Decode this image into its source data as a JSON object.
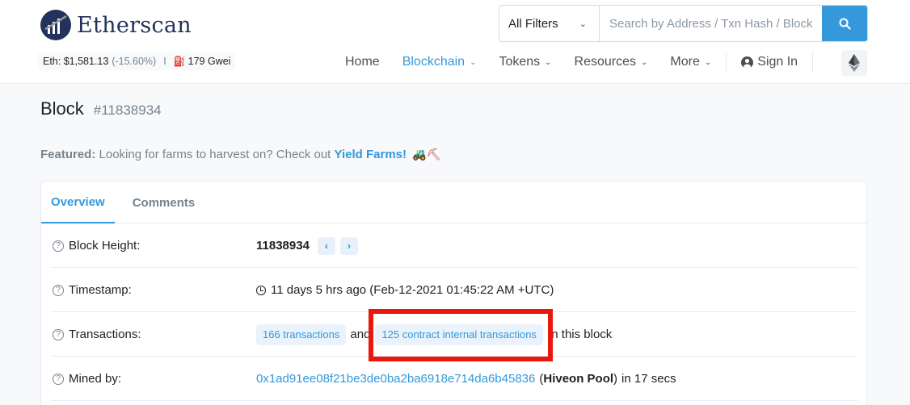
{
  "header": {
    "logo_text": "Etherscan",
    "price": {
      "eth_label": "Eth: $1,581.13",
      "change": "(-15.60%)",
      "separator": "I",
      "gas": "179 Gwei"
    },
    "search": {
      "filter_label": "All Filters",
      "placeholder": "Search by Address / Txn Hash / Block / Token / Ens"
    },
    "nav": {
      "home": "Home",
      "blockchain": "Blockchain",
      "tokens": "Tokens",
      "resources": "Resources",
      "more": "More",
      "sign_in": "Sign In"
    }
  },
  "page": {
    "title": "Block",
    "block_number": "#11838934",
    "featured": {
      "label": "Featured:",
      "text": "Looking for farms to harvest on? Check out",
      "link": "Yield Farms!",
      "emoji": "🚜⛏"
    }
  },
  "tabs": {
    "overview": "Overview",
    "comments": "Comments"
  },
  "details": {
    "block_height": {
      "label": "Block Height:",
      "value": "11838934",
      "prev": "‹",
      "next": "›"
    },
    "timestamp": {
      "label": "Timestamp:",
      "value": "11 days 5 hrs ago (Feb-12-2021 01:45:22 AM +UTC)"
    },
    "transactions": {
      "label": "Transactions:",
      "txn_link": "166 transactions",
      "and": "and",
      "internal_link": "125 contract internal transactions",
      "suffix": "in this block"
    },
    "mined_by": {
      "label": "Mined by:",
      "address": "0x1ad91ee08f21be3de0ba2ba6918e714da6b45836",
      "pool_open": "(",
      "pool": "Hiveon Pool",
      "pool_close": ")",
      "time": "in 17 secs"
    }
  },
  "colors": {
    "accent": "#3498db",
    "brand": "#21325b",
    "highlight": "#e8180e"
  }
}
